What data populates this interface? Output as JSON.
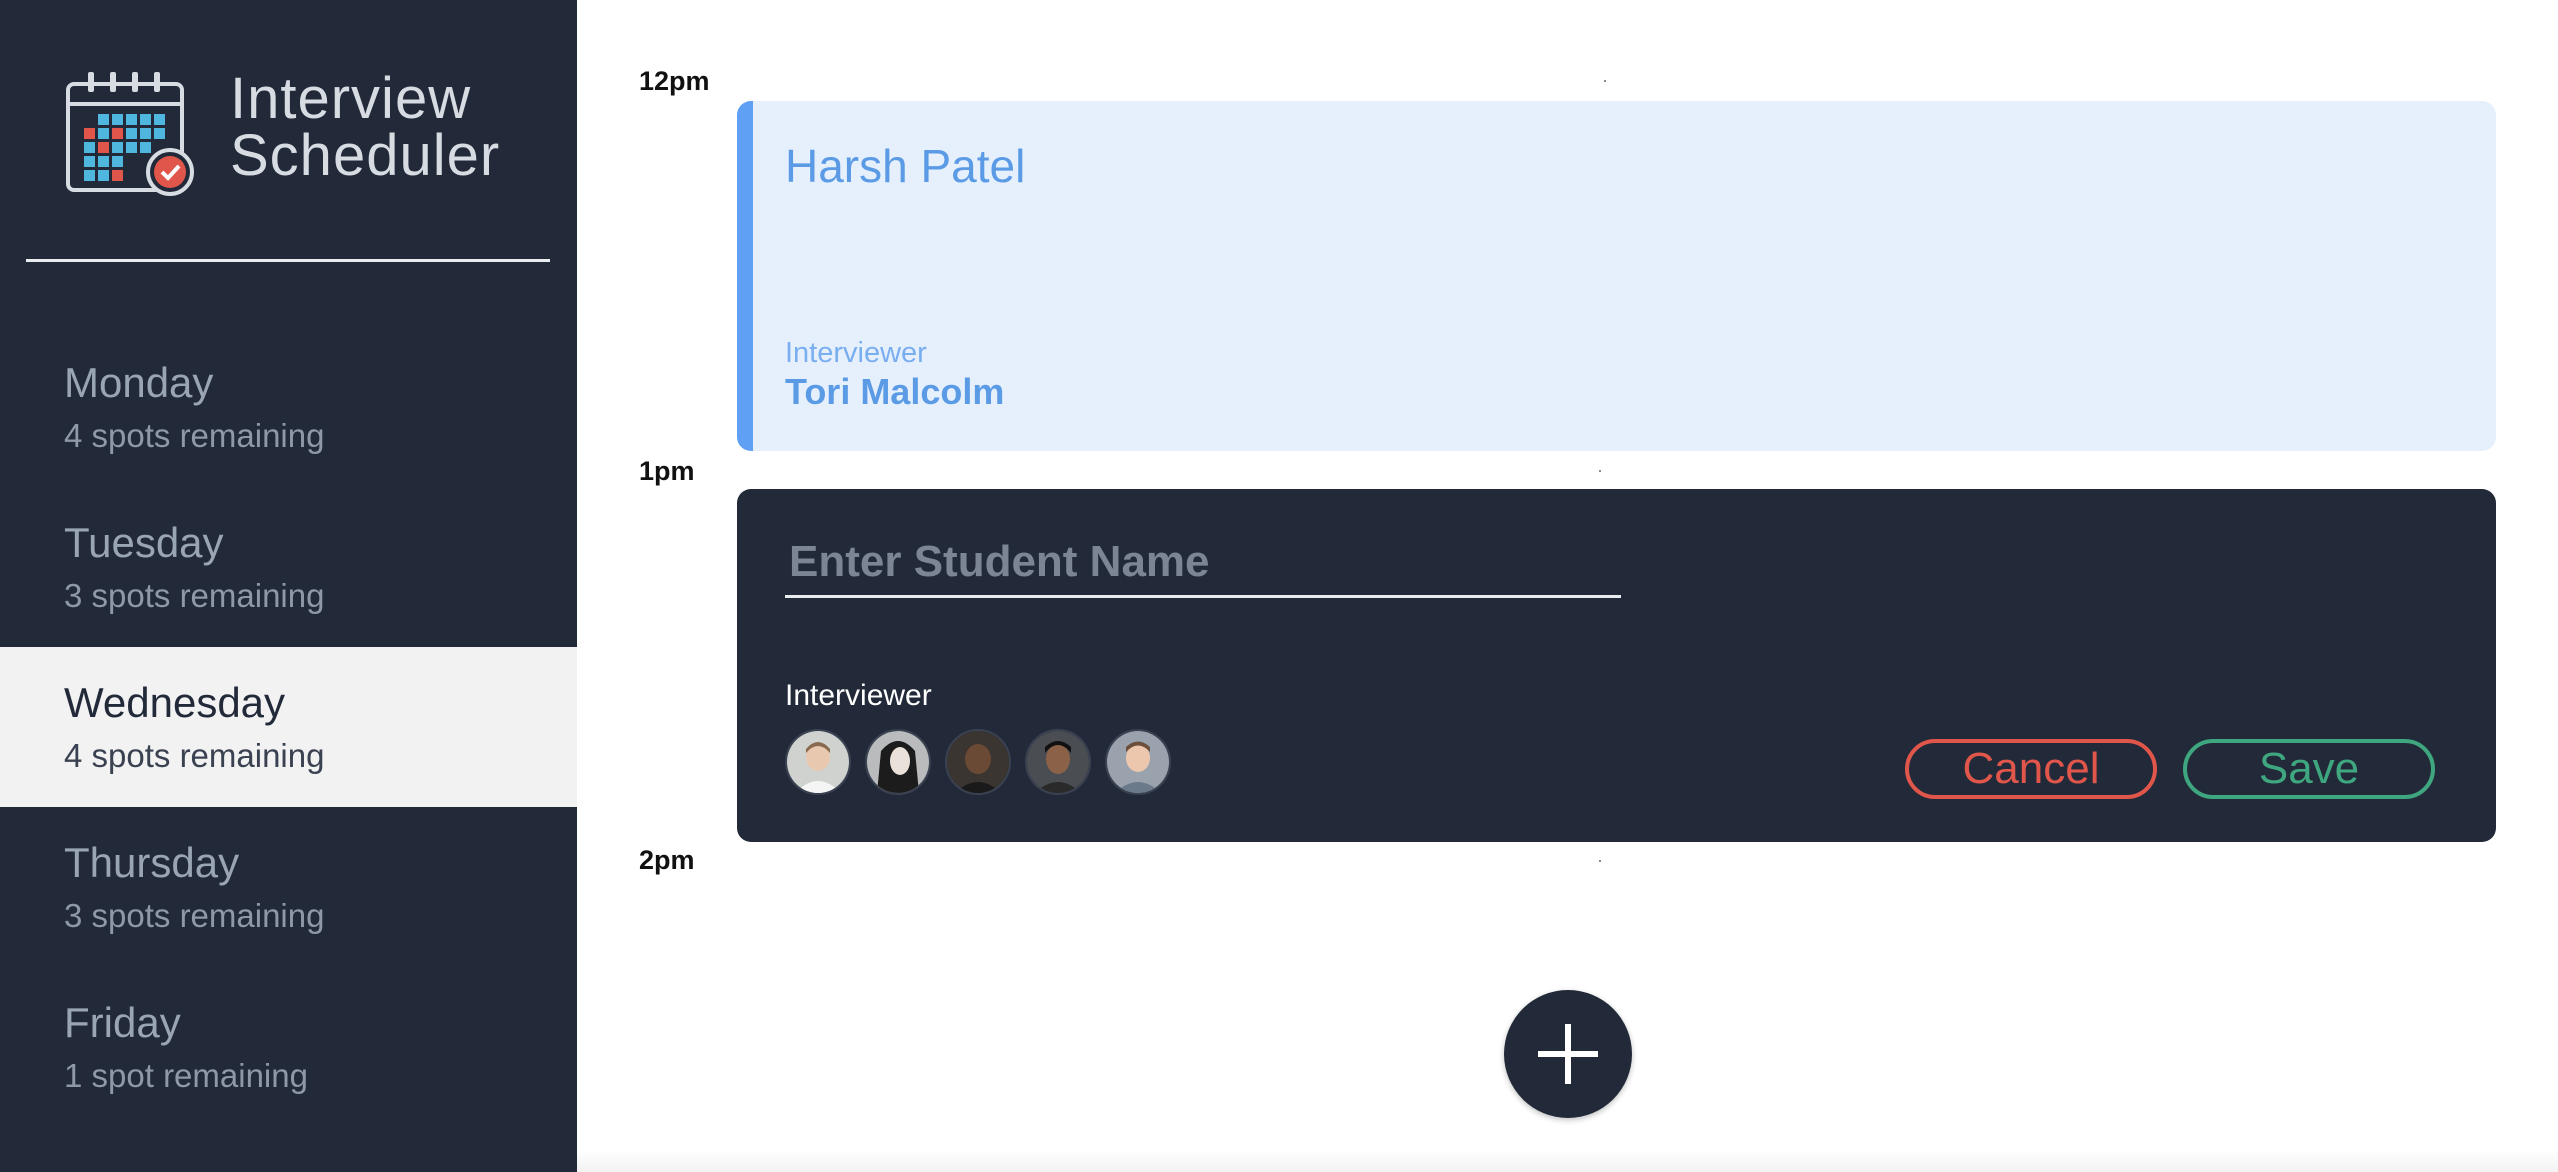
{
  "brand": {
    "line1": "Interview",
    "line2": "Scheduler",
    "logo_icon": "calendar-check-icon"
  },
  "days": [
    {
      "name": "Monday",
      "spots": "4 spots remaining",
      "selected": false
    },
    {
      "name": "Tuesday",
      "spots": "3 spots remaining",
      "selected": false
    },
    {
      "name": "Wednesday",
      "spots": "4 spots remaining",
      "selected": true
    },
    {
      "name": "Thursday",
      "spots": "3 spots remaining",
      "selected": false
    },
    {
      "name": "Friday",
      "spots": "1 spot remaining",
      "selected": false
    }
  ],
  "times": [
    "12pm",
    "1pm",
    "2pm"
  ],
  "appointment": {
    "student": "Harsh Patel",
    "interviewer_label": "Interviewer",
    "interviewer_name": "Tori Malcolm"
  },
  "form": {
    "student_placeholder": "Enter Student Name",
    "student_value": "",
    "interviewer_label": "Interviewer",
    "cancel_label": "Cancel",
    "save_label": "Save",
    "interviewers": [
      {
        "avatar": "avatar-1"
      },
      {
        "avatar": "avatar-2"
      },
      {
        "avatar": "avatar-3"
      },
      {
        "avatar": "avatar-4"
      },
      {
        "avatar": "avatar-5"
      }
    ]
  },
  "add_button": {
    "icon": "plus-icon"
  },
  "colors": {
    "sidebar_bg": "#222a39",
    "accent_blue": "#5fa0f4",
    "appointment_bg": "#e6f0fd",
    "cancel": "#e1564a",
    "save": "#3fa77f"
  }
}
